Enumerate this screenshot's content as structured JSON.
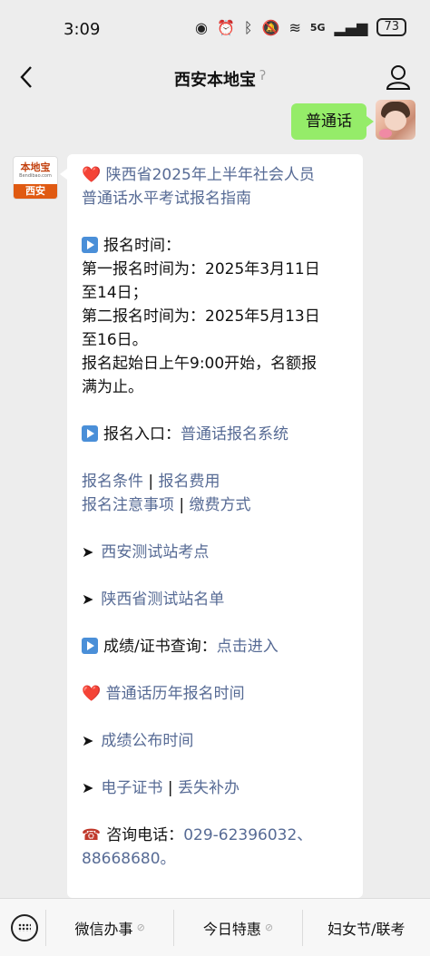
{
  "status": {
    "time": "3:09",
    "network": "5G",
    "battery": "73"
  },
  "nav": {
    "title": "西安本地宝"
  },
  "user_message": {
    "text": "普通话"
  },
  "bot": {
    "avatar": {
      "brand": "本地宝",
      "url": "Bendibao.com",
      "city": "西安"
    },
    "message": {
      "title_line1": "陕西省2025年上半年社会人员",
      "title_line2": "普通话水平考试报名指南",
      "reg_time_label": "报名时间：",
      "first_line1": "第一报名时间为：2025年3月11日",
      "first_line2": "至14日；",
      "second_line1": "第二报名时间为：2025年5月13日",
      "second_line2": "至16日。",
      "start_line1": "报名起始日上午9:00开始，名额报",
      "start_line2": "满为止。",
      "entry_label": "报名入口：",
      "entry_link": "普通话报名系统",
      "cond_link": "报名条件",
      "fee_link": "报名费用",
      "notes_link": "报名注意事项",
      "pay_link": "缴费方式",
      "xian_sites": "西安测试站考点",
      "shaanxi_sites": "陕西省测试站名单",
      "score_label": "成绩/证书查询：",
      "score_link": "点击进入",
      "history_link": "普通话历年报名时间",
      "results_link": "成绩公布时间",
      "ecert_link": "电子证书",
      "lost_link": "丢失补办",
      "phone_label": "咨询电话：",
      "phone_numbers_line1": "029-62396032、",
      "phone_numbers_line2": "88668680。"
    }
  },
  "bottom_menu": {
    "items": [
      "微信办事",
      "今日特惠",
      "妇女节/联考"
    ]
  },
  "colors": {
    "user_bubble": "#95ec69",
    "link": "#576b95",
    "background": "#ededed"
  }
}
